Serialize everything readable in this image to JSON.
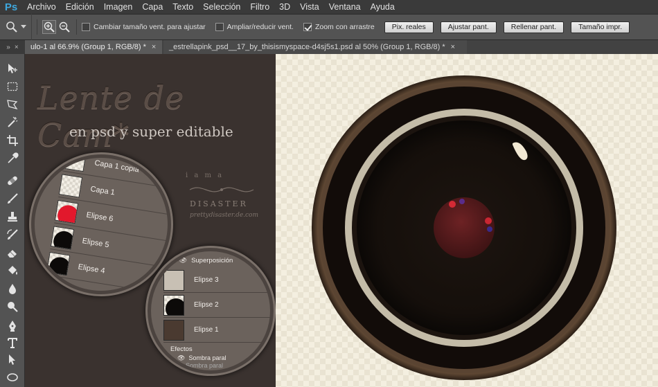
{
  "app": {
    "logo": "Ps"
  },
  "menu": [
    "Archivo",
    "Edición",
    "Imagen",
    "Capa",
    "Texto",
    "Selección",
    "Filtro",
    "3D",
    "Vista",
    "Ventana",
    "Ayuda"
  ],
  "options": {
    "cb_resize": {
      "label": "Cambiar tamaño vent. para ajustar",
      "checked": false
    },
    "cb_zoom_all": {
      "label": "Ampliar/reducir vent.",
      "checked": false
    },
    "cb_scrubby": {
      "label": "Zoom con arrastre",
      "checked": true
    },
    "btn_actual": "Pix. reales",
    "btn_fit": "Ajustar pant.",
    "btn_fill": "Rellenar pant.",
    "btn_print": "Tamaño impr."
  },
  "tabs": [
    {
      "label": "ulo-1 al 66.9% (Group 1, RGB/8) *",
      "close": "×"
    },
    {
      "label": "_estrellapink_psd__17_by_thisismyspace-d4sj5s1.psd al 50% (Group 1, RGB/8) *",
      "close": "×"
    }
  ],
  "artwork": {
    "title": "Lente de Cam*",
    "subtitle": "en psd y super editable",
    "watermark_top": "i a m a",
    "watermark_name": "DISASTER",
    "watermark_url": "prettydisaster.de.com",
    "layers_a": [
      "Capa 1 copia",
      "Capa 1",
      "Elipse 6",
      "Elipse 5",
      "Elipse 4"
    ],
    "layers_b": [
      "Superposición",
      "Elipse 3",
      "Elipse 2",
      "Elipse 1",
      "Efectos",
      "Sombra paral",
      "Sombra paral"
    ]
  },
  "colors": {
    "accent": "#3ea8de",
    "lens_ring": "#c4bca8",
    "lens_outer": "#54412f",
    "lens_pupil": "#5a1a1c"
  }
}
